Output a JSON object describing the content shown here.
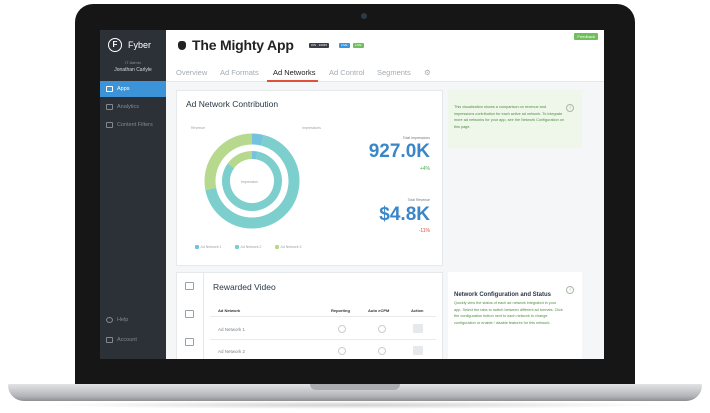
{
  "brand": {
    "name": "Fyber",
    "logo_letter": "F"
  },
  "user": {
    "role": "IT Admin",
    "name": "Jonathan Carlyle"
  },
  "sidebar": {
    "items": [
      {
        "label": "Apps",
        "icon": "apps-icon",
        "active": true
      },
      {
        "label": "Analytics",
        "icon": "bar-chart-icon",
        "active": false
      },
      {
        "label": "Content Filters",
        "icon": "filter-icon",
        "active": false
      }
    ],
    "bottom_items": [
      {
        "label": "Help",
        "icon": "help-icon"
      },
      {
        "label": "Account",
        "icon": "account-icon"
      }
    ]
  },
  "header": {
    "app_title": "The Mighty App",
    "badges": [
      {
        "label": "iOS · 10045",
        "color": "#3a3f45"
      },
      {
        "label": "LIVE",
        "color": "#3d93d8"
      },
      {
        "label": "LIVE",
        "color": "#6fbf5a"
      }
    ],
    "feedback_label": "Feedback",
    "tabs": [
      {
        "label": "Overview",
        "active": false
      },
      {
        "label": "Ad Formats",
        "active": false
      },
      {
        "label": "Ad Networks",
        "active": true
      },
      {
        "label": "Ad Control",
        "active": false
      },
      {
        "label": "Segments",
        "active": false
      }
    ]
  },
  "contribution": {
    "title": "Ad Network Contribution",
    "inner_label": "Impression",
    "left_label": "Revenue",
    "right_label": "Impressions",
    "impressions_label": "Total Impressions",
    "impressions_value": "927.0K",
    "impressions_delta": "+4%",
    "revenue_label": "Total Revenue",
    "revenue_value": "$4.8K",
    "revenue_delta": "-11%",
    "legend": [
      {
        "label": "Ad Network 1",
        "color": "#75c2de"
      },
      {
        "label": "Ad Network 2",
        "color": "#7ccfcc"
      },
      {
        "label": "Ad Network 3",
        "color": "#b7d98d"
      }
    ],
    "outer_ring": {
      "Ad Network 1": 0.04,
      "Ad Network 2": 0.68,
      "Ad Network 3": 0.28
    },
    "inner_ring": {
      "Ad Network 1": 0.03,
      "Ad Network 2": 0.82,
      "Ad Network 3": 0.15
    }
  },
  "info_top": {
    "text": "This visualization shows a comparison on revenue and impressions contribution for each active ad network. To integrate more ad networks for your app, see the Network Configuration on this page."
  },
  "rewarded": {
    "title": "Rewarded Video",
    "columns": [
      "Ad Network",
      "Reporting",
      "Auto eCPM",
      "Action"
    ],
    "rows": [
      {
        "name": "Ad Network 1"
      },
      {
        "name": "Ad Network 2"
      }
    ]
  },
  "info_bottom": {
    "title": "Network Configuration and Status",
    "text": "Quickly view the status of each ad network integrated in your app. Select the tabs to switch between different ad formats. Click the configuration button next to each network to change configuration or enable / disable features for this network."
  },
  "colors": {
    "accent": "#3d93d8",
    "sidebar_bg": "#2c3138",
    "positive": "#4caf50",
    "negative": "#e0513a",
    "metric_blue": "#3a86c8"
  }
}
